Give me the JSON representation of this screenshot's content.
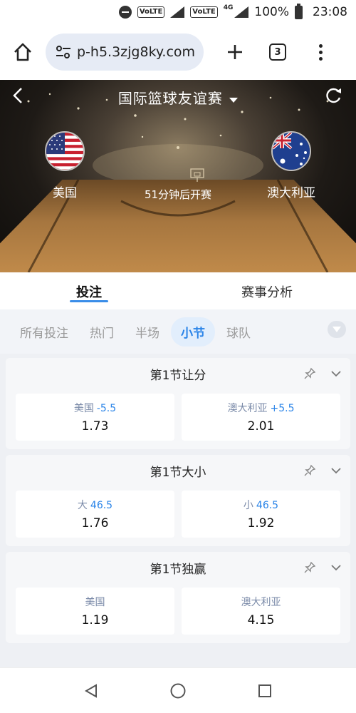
{
  "status_bar": {
    "volte1": "VoLTE",
    "volte2": "VoLTE",
    "network": "4G",
    "battery": "100%",
    "time": "23:08"
  },
  "browser": {
    "url": "p-h5.3zjg8ky.com",
    "tab_count": "3"
  },
  "hero": {
    "title": "国际篮球友谊赛",
    "home_team": "美国",
    "away_team": "澳大利亚",
    "kickoff_text": "51分钟后开赛"
  },
  "main_tabs": [
    {
      "label": "投注",
      "active": true
    },
    {
      "label": "赛事分析",
      "active": false
    }
  ],
  "filters": [
    {
      "label": "所有投注",
      "active": false
    },
    {
      "label": "热门",
      "active": false
    },
    {
      "label": "半场",
      "active": false
    },
    {
      "label": "小节",
      "active": true
    },
    {
      "label": "球队",
      "active": false
    }
  ],
  "markets": [
    {
      "title": "第1节让分",
      "options": [
        {
          "name": "美国",
          "line": "-5.5",
          "odds": "1.73"
        },
        {
          "name": "澳大利亚",
          "line": "+5.5",
          "odds": "2.01"
        }
      ]
    },
    {
      "title": "第1节大小",
      "options": [
        {
          "name": "大",
          "line": "46.5",
          "odds": "1.76"
        },
        {
          "name": "小",
          "line": "46.5",
          "odds": "1.92"
        }
      ]
    },
    {
      "title": "第1节独赢",
      "options": [
        {
          "name": "美国",
          "line": "",
          "odds": "1.19"
        },
        {
          "name": "澳大利亚",
          "line": "",
          "odds": "4.15"
        }
      ]
    }
  ],
  "colors": {
    "accent": "#2a84e8",
    "tab_underline": "#3a8de8",
    "chip_active_bg": "#e2eefc"
  },
  "icons": {
    "home": "home-icon",
    "site_settings": "tune-icon",
    "new_tab": "plus-icon",
    "tabs": "tabs-icon",
    "menu": "more-vert-icon",
    "back": "chevron-left-icon",
    "title_dropdown": "caret-down-icon",
    "refresh": "refresh-icon",
    "pin": "pin-icon",
    "collapse": "chevron-down-icon",
    "nav_back": "triangle-back-icon",
    "nav_home": "circle-home-icon",
    "nav_recents": "square-recents-icon"
  }
}
